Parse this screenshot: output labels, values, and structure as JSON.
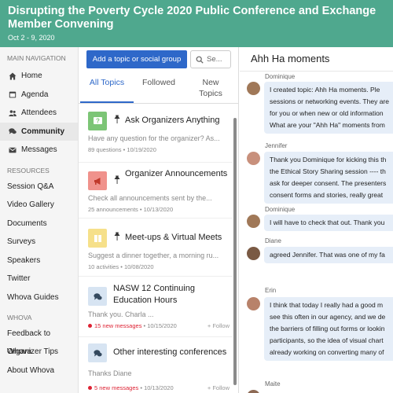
{
  "header": {
    "title": "Disrupting the Poverty Cycle 2020 Public Conference and Exchange Member Convening",
    "dates": "Oct 2 - 9, 2020"
  },
  "sidebar": {
    "main_label": "MAIN NAVIGATION",
    "nav": [
      {
        "label": "Home",
        "icon": "home-icon"
      },
      {
        "label": "Agenda",
        "icon": "calendar-icon"
      },
      {
        "label": "Attendees",
        "icon": "people-icon"
      },
      {
        "label": "Community",
        "icon": "chat-bubbles-icon",
        "active": true
      },
      {
        "label": "Messages",
        "icon": "envelope-icon"
      }
    ],
    "resources_label": "RESOURCES",
    "resources": [
      "Session Q&A",
      "Video Gallery",
      "Documents",
      "Surveys",
      "Speakers",
      "Twitter",
      "Whova Guides"
    ],
    "whova_label": "WHOVA",
    "whova": [
      "Feedback to Whova",
      "Organizer Tips",
      "About Whova"
    ]
  },
  "middle": {
    "add_button": "Add a topic or social group",
    "search_placeholder": "Se...",
    "tabs": [
      "All Topics",
      "Followed",
      "New Topics"
    ],
    "topics": [
      {
        "title": "Ask Organizers Anything",
        "pinned": true,
        "desc": "Have any question for the organizer? As...",
        "count": "89 questions",
        "date": "10/19/2020",
        "icon": "question-icon",
        "tile_color": "#7cc576"
      },
      {
        "title": "Organizer Announcements",
        "pinned": true,
        "desc": "Check all announcements sent by the...",
        "count": "25 announcements",
        "date": "10/13/2020",
        "icon": "megaphone-icon",
        "tile_color": "#f0928c"
      },
      {
        "title": "Meet-ups & Virtual Meets",
        "pinned": true,
        "desc": "Suggest a dinner together, a morning ru...",
        "count": "10 activities",
        "date": "10/08/2020",
        "icon": "meetup-icon",
        "tile_color": "#f6e08a"
      },
      {
        "title": "NASW 12 Continuing Education Hours",
        "pinned": false,
        "desc": "Thank you. Charla ...",
        "count": "15 new messages",
        "date": "10/15/2020",
        "icon": "chat-icon",
        "tile_color": "#d7e4f2",
        "follow": "Follow"
      },
      {
        "title": "Other interesting conferences",
        "pinned": false,
        "desc": "Thanks Diane",
        "count": "5 new messages",
        "date": "10/13/2020",
        "icon": "chat-icon",
        "tile_color": "#d7e4f2",
        "follow": "Follow"
      }
    ]
  },
  "chat": {
    "title": "Ahh Ha moments",
    "messages": [
      {
        "name": "Dominique",
        "lines": [
          "I created topic: Ahh Ha moments. Ple",
          "sessions or networking events. They are",
          "for you or when new or old information",
          "What are your \"Ahh Ha\" moments from"
        ]
      },
      {
        "name": "Jennifer",
        "lines": [
          "Thank you Dominique for kicking this th",
          "the Ethical Story Sharing session ---- th",
          "ask for deeper consent. The presenters",
          "consent forms and stories, really great"
        ]
      },
      {
        "name": "Dominique",
        "lines": [
          "I will have to check that out. Thank you"
        ]
      },
      {
        "name": "Diane",
        "lines": [
          "agreed Jennifer. That was one of my fa"
        ]
      },
      {
        "name": "Erin",
        "lines": [
          "I think that today I really had a good m",
          "see this often in our agency, and we de",
          "the barriers of filling out forms or lookin",
          "participants, so the idea of visual chart",
          "already working on converting many of"
        ]
      },
      {
        "name": "Maite",
        "lines": []
      }
    ]
  }
}
